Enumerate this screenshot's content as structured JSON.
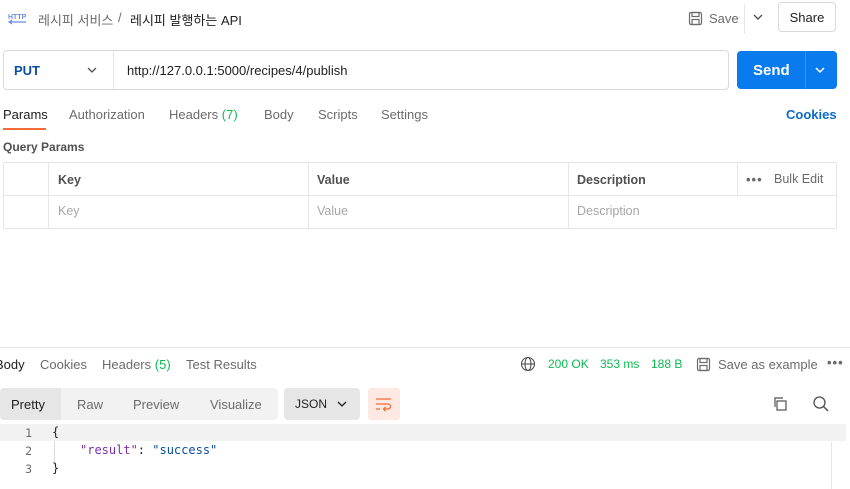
{
  "header": {
    "breadcrumb_parent": "레시피 서비스",
    "breadcrumb_sep": "/",
    "breadcrumb_current": "레시피 발행하는 API",
    "save_label": "Save",
    "share_label": "Share"
  },
  "request": {
    "method": "PUT",
    "url": "http://127.0.0.1:5000/recipes/4/publish",
    "send_label": "Send"
  },
  "tabs": [
    {
      "label": "Params",
      "count": ""
    },
    {
      "label": "Authorization",
      "count": ""
    },
    {
      "label": "Headers",
      "count": "(7)"
    },
    {
      "label": "Body",
      "count": ""
    },
    {
      "label": "Scripts",
      "count": ""
    },
    {
      "label": "Settings",
      "count": ""
    }
  ],
  "cookies_link": "Cookies",
  "query_params": {
    "title": "Query Params",
    "columns": [
      "Key",
      "Value",
      "Description"
    ],
    "placeholders": [
      "Key",
      "Value",
      "Description"
    ],
    "bulk_dots": "•••",
    "bulk_edit": "Bulk Edit"
  },
  "response": {
    "tabs": [
      {
        "label": "Body",
        "count": ""
      },
      {
        "label": "Cookies",
        "count": ""
      },
      {
        "label": "Headers",
        "count": "(5)"
      },
      {
        "label": "Test Results",
        "count": ""
      }
    ],
    "status": "200 OK",
    "time": "353 ms",
    "size": "188 B",
    "save_example": "Save as example",
    "more": "•••",
    "view_tabs": [
      "Pretty",
      "Raw",
      "Preview",
      "Visualize"
    ],
    "format": "JSON",
    "line_numbers": [
      "1",
      "2",
      "3"
    ],
    "code": {
      "open": "{",
      "key": "\"result\"",
      "colon": ": ",
      "value": "\"success\"",
      "close": "}"
    }
  },
  "colors": {
    "accent_orange": "#f26b3a",
    "send_blue": "#097bed",
    "status_green": "#0cbb52",
    "link_blue": "#0b6bcb"
  }
}
